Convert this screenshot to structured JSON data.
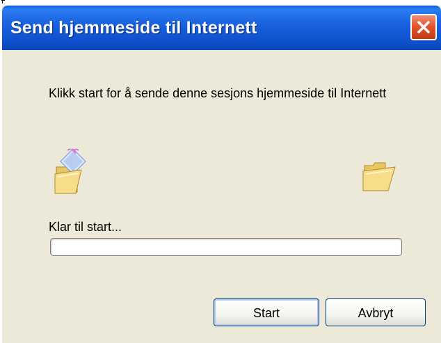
{
  "window": {
    "title": "Send hjemmeside til Internett"
  },
  "titlebar": {
    "close_icon": "close-icon"
  },
  "content": {
    "message": "Klikk start for å sende denne sesjons hjemmeside til Internett",
    "source_icon": "folder-open-with-page-icon",
    "target_icon": "folder-open-icon",
    "status": "Klar til start...",
    "progress": 0
  },
  "buttons": {
    "start_label": "Start",
    "cancel_label": "Avbryt"
  },
  "colors": {
    "titlebar": "#0B5BD8",
    "dialog_bg": "#ECE9D8",
    "close": "#E2552F"
  }
}
